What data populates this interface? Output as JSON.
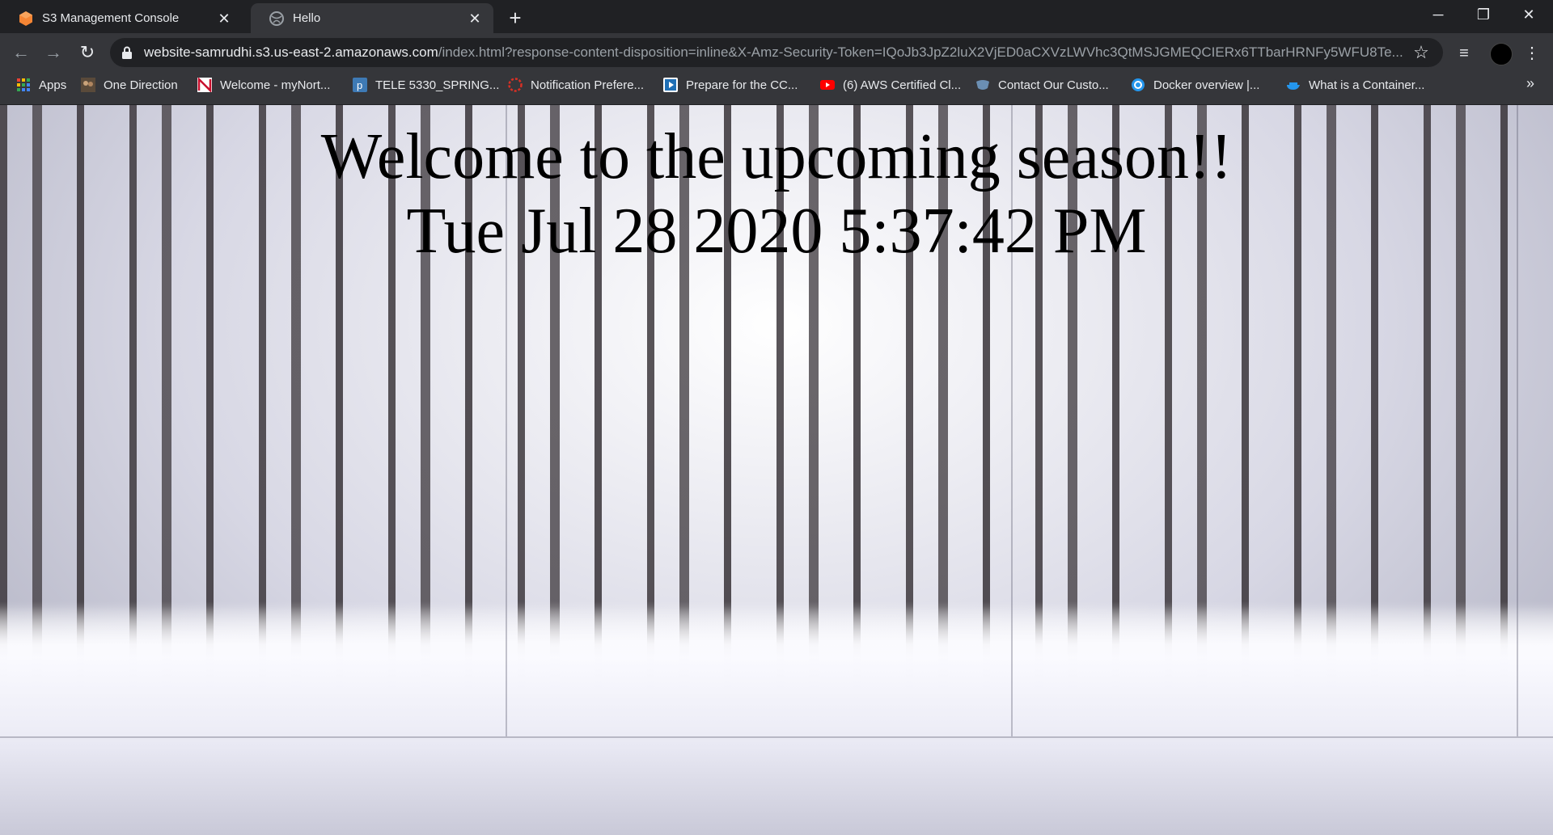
{
  "tabs": [
    {
      "title": "S3 Management Console",
      "favicon": "aws-s3-icon",
      "active": false
    },
    {
      "title": "Hello",
      "favicon": "globe-icon",
      "active": true
    }
  ],
  "toolbar": {
    "url_host": "website-samrudhi.s3.us-east-2.amazonaws.com",
    "url_rest": "/index.html?response-content-disposition=inline&X-Amz-Security-Token=IQoJb3JpZ2luX2VjED0aCXVzLWVhc3QtMSJGMEQCIERx6TTbarHRNFy5WFU8Te..."
  },
  "bookmarks": [
    {
      "label": "Apps",
      "icon": "apps-grid-icon"
    },
    {
      "label": "One Direction",
      "icon": "bookmark-image-icon"
    },
    {
      "label": "Welcome - myNort...",
      "icon": "northeastern-icon"
    },
    {
      "label": "TELE 5330_SPRING...",
      "icon": "piazza-icon"
    },
    {
      "label": "Notification Prefere...",
      "icon": "notification-icon"
    },
    {
      "label": "Prepare for the CC...",
      "icon": "video-course-icon"
    },
    {
      "label": "(6) AWS Certified Cl...",
      "icon": "youtube-icon"
    },
    {
      "label": "Contact Our Custo...",
      "icon": "shield-icon"
    },
    {
      "label": "Docker overview |...",
      "icon": "docker-icon"
    },
    {
      "label": "What is a Container...",
      "icon": "docker-whale-icon"
    }
  ],
  "page": {
    "heading_line1": "Welcome to the upcoming season!!",
    "heading_line2": "Tue Jul 28 2020 5:37:42 PM"
  },
  "colors": {
    "chrome_dark": "#202124",
    "chrome_tab": "#35363a",
    "text_light": "#e8eaed"
  }
}
